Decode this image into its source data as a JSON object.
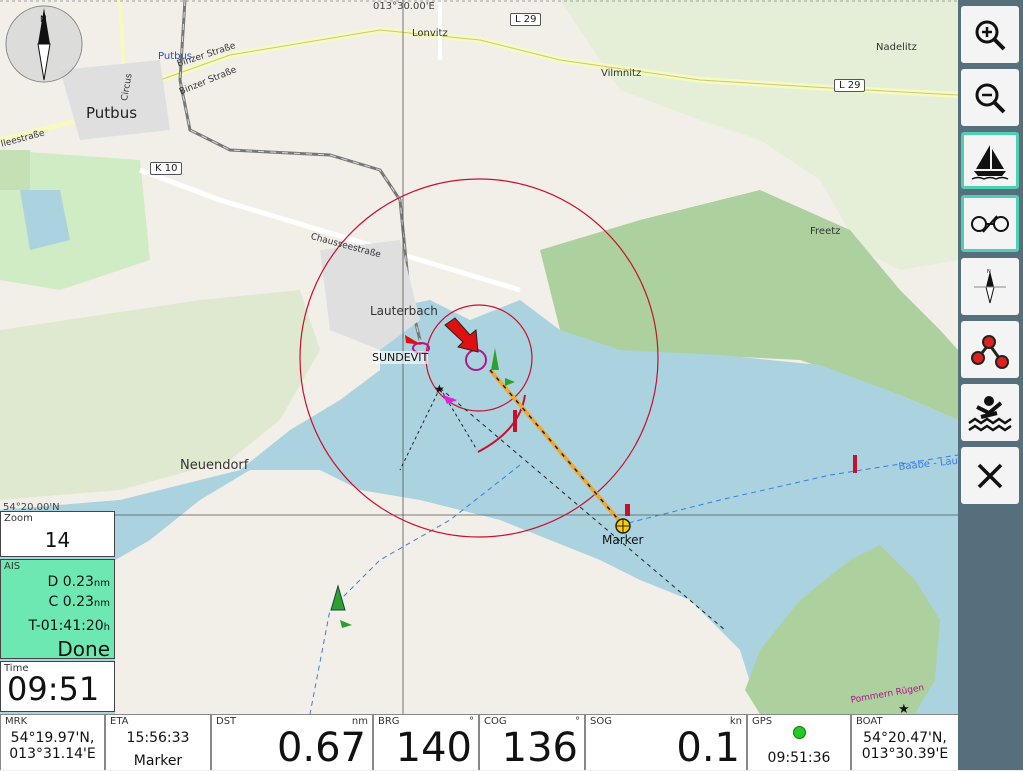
{
  "map": {
    "longitude_label": "013°30.00'E",
    "latitude_label": "54°20.00'N",
    "places": [
      "Lonvitz",
      "Nadelitz",
      "Vilmnitz",
      "Putbus",
      "Freetz",
      "Lauterbach",
      "Neuendorf"
    ],
    "streets": [
      "Binzer Straße",
      "Binzer Straße",
      "Circus",
      "Chausseestraße",
      "lleestraße"
    ],
    "roads": [
      "L 29",
      "L 29",
      "K 10"
    ],
    "station_label": "Putbus",
    "vessel_label": "SUNDEVIT",
    "waypoint_label": "Marker",
    "route_label": "Baabe - Laut",
    "island_label": "Pommern Rügen"
  },
  "toolbar": {
    "buttons": [
      {
        "name": "zoom-in",
        "icon": "zoom-in-icon",
        "active": false
      },
      {
        "name": "zoom-out",
        "icon": "zoom-out-icon",
        "active": false
      },
      {
        "name": "boat-center",
        "icon": "sailboat-icon",
        "active": true
      },
      {
        "name": "ais",
        "icon": "ais-icon",
        "active": true
      },
      {
        "name": "compass",
        "icon": "compass-icon",
        "active": false
      },
      {
        "name": "route",
        "icon": "route-icon",
        "active": false
      },
      {
        "name": "mob",
        "icon": "man-overboard-icon",
        "active": false
      },
      {
        "name": "close",
        "icon": "close-icon",
        "active": false
      }
    ]
  },
  "widgets": {
    "zoom": {
      "caption": "Zoom",
      "value": "14"
    },
    "ais": {
      "caption": "AIS",
      "d_label": "D",
      "d_value": "0.23",
      "d_unit": "nm",
      "c_label": "C",
      "c_value": "0.23",
      "c_unit": "nm",
      "t_label": "T",
      "t_value": "-01:41:20",
      "t_unit": "h",
      "status": "Done"
    },
    "time": {
      "caption": "Time",
      "value": "09:51"
    }
  },
  "bottom": {
    "mrk": {
      "caption": "MRK",
      "lat": "54°19.97'N,",
      "lon": "013°31.14'E"
    },
    "eta": {
      "caption": "ETA",
      "time": "15:56:33",
      "name": "Marker"
    },
    "dst": {
      "caption": "DST",
      "unit": "nm",
      "value": "0.67"
    },
    "brg": {
      "caption": "BRG",
      "unit": "°",
      "value": "140"
    },
    "cog": {
      "caption": "COG",
      "unit": "°",
      "value": "136"
    },
    "sog": {
      "caption": "SOG",
      "unit": "kn",
      "value": "0.1"
    },
    "gps": {
      "caption": "GPS",
      "time": "09:51:36",
      "status_color": "#22cc22"
    },
    "boat": {
      "caption": "BOAT",
      "lat": "54°20.47'N,",
      "lon": "013°30.39'E"
    }
  }
}
